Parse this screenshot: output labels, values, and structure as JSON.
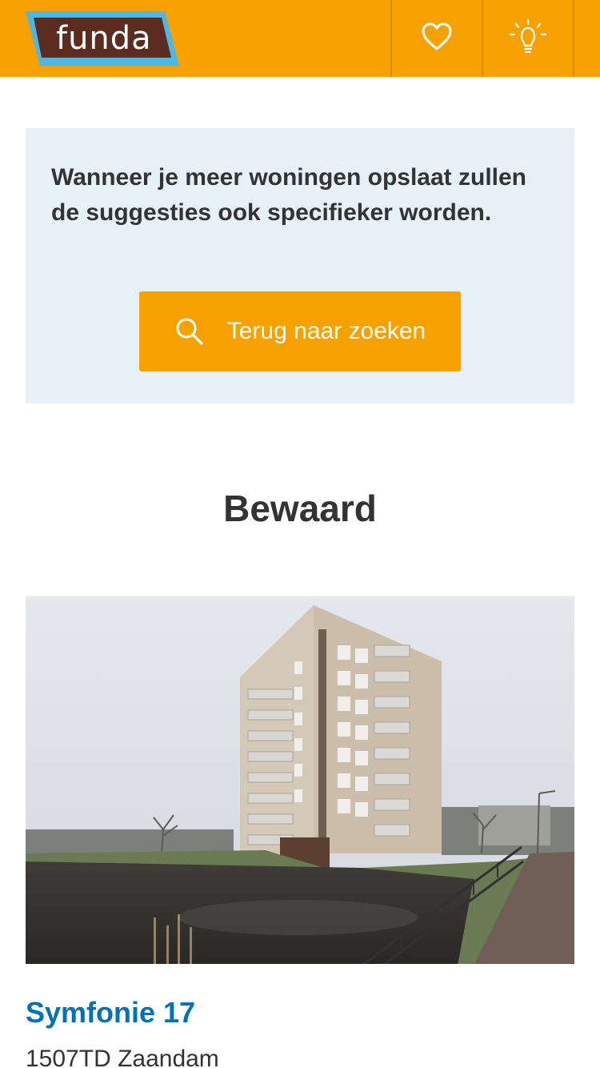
{
  "header": {
    "logo_text": "funda",
    "favorites_icon": "heart-icon",
    "tips_icon": "lightbulb-icon",
    "brand_color": "#f7a100"
  },
  "info": {
    "message": "Wanneer je meer woningen opslaat zullen de suggesties ook specifieker worden.",
    "button_label": "Terug naar zoeken",
    "button_icon": "search-icon"
  },
  "saved": {
    "title": "Bewaard"
  },
  "listing": {
    "title": "Symfonie 17",
    "address": "1507TD Zaandam",
    "title_color": "#0071b3"
  }
}
